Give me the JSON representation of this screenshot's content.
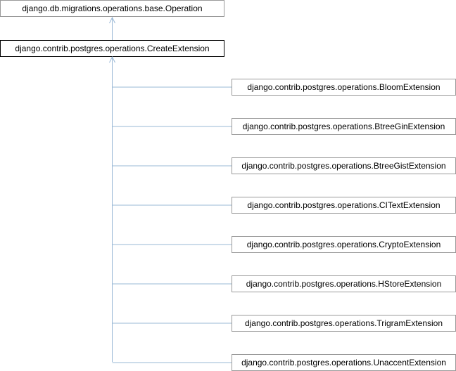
{
  "diagram": {
    "base": {
      "label": "django.db.migrations.operations.base.Operation"
    },
    "focus": {
      "label": "django.contrib.postgres.operations.CreateExtension"
    },
    "children": [
      {
        "label": "django.contrib.postgres.operations.BloomExtension"
      },
      {
        "label": "django.contrib.postgres.operations.BtreeGinExtension"
      },
      {
        "label": "django.contrib.postgres.operations.BtreeGistExtension"
      },
      {
        "label": "django.contrib.postgres.operations.CITextExtension"
      },
      {
        "label": "django.contrib.postgres.operations.CryptoExtension"
      },
      {
        "label": "django.contrib.postgres.operations.HStoreExtension"
      },
      {
        "label": "django.contrib.postgres.operations.TrigramExtension"
      },
      {
        "label": "django.contrib.postgres.operations.UnaccentExtension"
      }
    ],
    "colors": {
      "edge": "#9ab8d6",
      "focus_border": "#000000",
      "node_border": "#999999"
    }
  }
}
